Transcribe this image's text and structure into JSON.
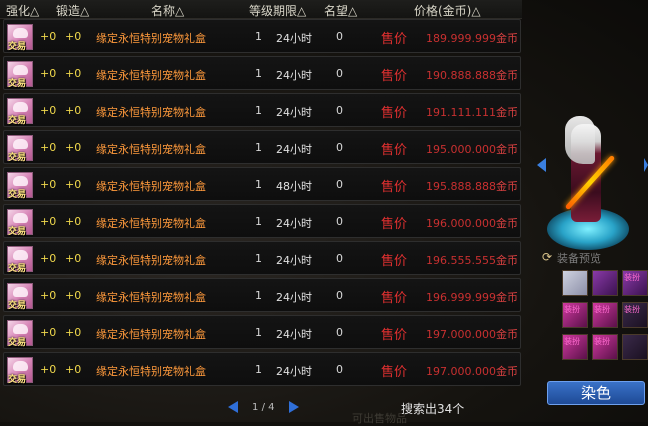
{
  "header": {
    "upgrade": "强化△",
    "forge": "锻造△",
    "name": "名称△",
    "level_period": "等级期限△",
    "reputation": "名望△",
    "price": "价格(金币)△"
  },
  "rows": [
    {
      "upgrade": "+0",
      "forge": "+0",
      "name": "缘定永恒特别宠物礼盒",
      "level": "1",
      "period": "24小时",
      "reputation": "0",
      "sell": "售价",
      "price": "189.999.999",
      "unit": "金币",
      "icon_label": "交易"
    },
    {
      "upgrade": "+0",
      "forge": "+0",
      "name": "缘定永恒特别宠物礼盒",
      "level": "1",
      "period": "24小时",
      "reputation": "0",
      "sell": "售价",
      "price": "190.888.888",
      "unit": "金币",
      "icon_label": "交易"
    },
    {
      "upgrade": "+0",
      "forge": "+0",
      "name": "缘定永恒特别宠物礼盒",
      "level": "1",
      "period": "24小时",
      "reputation": "0",
      "sell": "售价",
      "price": "191.111.111",
      "unit": "金币",
      "icon_label": "交易"
    },
    {
      "upgrade": "+0",
      "forge": "+0",
      "name": "缘定永恒特别宠物礼盒",
      "level": "1",
      "period": "24小时",
      "reputation": "0",
      "sell": "售价",
      "price": "195.000.000",
      "unit": "金币",
      "icon_label": "交易"
    },
    {
      "upgrade": "+0",
      "forge": "+0",
      "name": "缘定永恒特别宠物礼盒",
      "level": "1",
      "period": "48小时",
      "reputation": "0",
      "sell": "售价",
      "price": "195.888.888",
      "unit": "金币",
      "icon_label": "交易"
    },
    {
      "upgrade": "+0",
      "forge": "+0",
      "name": "缘定永恒特别宠物礼盒",
      "level": "1",
      "period": "24小时",
      "reputation": "0",
      "sell": "售价",
      "price": "196.000.000",
      "unit": "金币",
      "icon_label": "交易"
    },
    {
      "upgrade": "+0",
      "forge": "+0",
      "name": "缘定永恒特别宠物礼盒",
      "level": "1",
      "period": "24小时",
      "reputation": "0",
      "sell": "售价",
      "price": "196.555.555",
      "unit": "金币",
      "icon_label": "交易"
    },
    {
      "upgrade": "+0",
      "forge": "+0",
      "name": "缘定永恒特别宠物礼盒",
      "level": "1",
      "period": "24小时",
      "reputation": "0",
      "sell": "售价",
      "price": "196.999.999",
      "unit": "金币",
      "icon_label": "交易"
    },
    {
      "upgrade": "+0",
      "forge": "+0",
      "name": "缘定永恒特别宠物礼盒",
      "level": "1",
      "period": "24小时",
      "reputation": "0",
      "sell": "售价",
      "price": "197.000.000",
      "unit": "金币",
      "icon_label": "交易"
    },
    {
      "upgrade": "+0",
      "forge": "+0",
      "name": "缘定永恒特别宠物礼盒",
      "level": "1",
      "period": "24小时",
      "reputation": "0",
      "sell": "售价",
      "price": "197.000.000",
      "unit": "金币",
      "icon_label": "交易"
    }
  ],
  "pagination": {
    "current": "1",
    "separator": "/",
    "total": "4"
  },
  "search_result": "搜索出34个",
  "background_text": "可出售物品",
  "equip_label": "装备预览",
  "equip_slots": [
    {
      "tag": "",
      "style": "hair"
    },
    {
      "tag": "",
      "style": "purple"
    },
    {
      "tag": "装扮",
      "style": "purple"
    },
    {
      "tag": "装扮",
      "style": "magenta"
    },
    {
      "tag": "装扮",
      "style": "magenta"
    },
    {
      "tag": "装扮",
      "style": "dark"
    },
    {
      "tag": "装扮",
      "style": "magenta"
    },
    {
      "tag": "装扮",
      "style": "magenta"
    },
    {
      "tag": "",
      "style": "dark"
    }
  ],
  "dye_button": "染色",
  "colors": {
    "price": "#c83030",
    "sell": "#e03030",
    "name": "#ff9a3c",
    "upgrade": "#f0d84c",
    "accent_blue": "#2f6fd8"
  }
}
